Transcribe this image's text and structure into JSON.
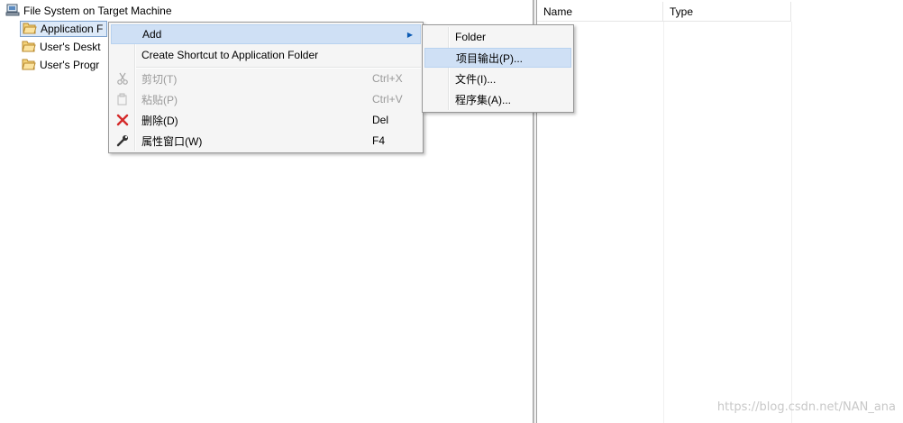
{
  "tree": {
    "root_label": "File System on Target Machine",
    "items": [
      {
        "label": "Application F",
        "selected": true
      },
      {
        "label": "User's Deskt",
        "selected": false
      },
      {
        "label": "User's Progr",
        "selected": false
      }
    ]
  },
  "list": {
    "columns": [
      "Name",
      "Type"
    ]
  },
  "context_menu": {
    "items": [
      {
        "label": "Add",
        "shortcut": "",
        "disabled": false,
        "icon": "",
        "submenu": true
      },
      {
        "label": "Create Shortcut to Application Folder",
        "shortcut": "",
        "disabled": false,
        "icon": ""
      },
      {
        "label": "剪切(T)",
        "shortcut": "Ctrl+X",
        "disabled": true,
        "icon": "scissors-icon"
      },
      {
        "label": "粘贴(P)",
        "shortcut": "Ctrl+V",
        "disabled": true,
        "icon": "paste-icon"
      },
      {
        "label": "删除(D)",
        "shortcut": "Del",
        "disabled": false,
        "icon": "delete-icon"
      },
      {
        "label": "属性窗口(W)",
        "shortcut": "F4",
        "disabled": false,
        "icon": "wrench-icon"
      }
    ]
  },
  "add_submenu": {
    "items": [
      {
        "label": "Folder"
      },
      {
        "label": "项目输出(P)..."
      },
      {
        "label": "文件(I)..."
      },
      {
        "label": "程序集(A)..."
      }
    ]
  },
  "watermark": "https://blog.csdn.net/NAN_ana",
  "colors": {
    "menu_bg": "#f5f5f5",
    "highlight": "#cfe0f5",
    "delete_red": "#d42a2a"
  }
}
